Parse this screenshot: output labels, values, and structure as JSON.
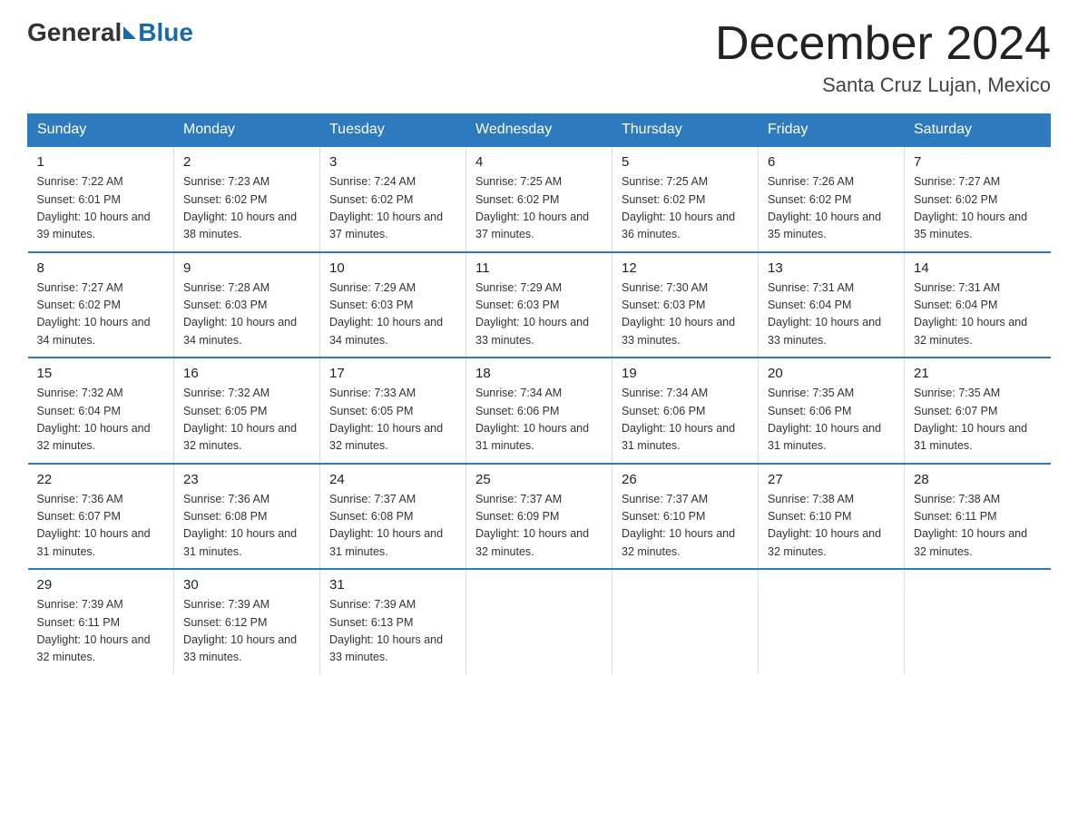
{
  "logo": {
    "general": "General",
    "blue": "Blue"
  },
  "title": "December 2024",
  "location": "Santa Cruz Lujan, Mexico",
  "days_of_week": [
    "Sunday",
    "Monday",
    "Tuesday",
    "Wednesday",
    "Thursday",
    "Friday",
    "Saturday"
  ],
  "weeks": [
    [
      {
        "day": "1",
        "sunrise": "7:22 AM",
        "sunset": "6:01 PM",
        "daylight": "10 hours and 39 minutes."
      },
      {
        "day": "2",
        "sunrise": "7:23 AM",
        "sunset": "6:02 PM",
        "daylight": "10 hours and 38 minutes."
      },
      {
        "day": "3",
        "sunrise": "7:24 AM",
        "sunset": "6:02 PM",
        "daylight": "10 hours and 37 minutes."
      },
      {
        "day": "4",
        "sunrise": "7:25 AM",
        "sunset": "6:02 PM",
        "daylight": "10 hours and 37 minutes."
      },
      {
        "day": "5",
        "sunrise": "7:25 AM",
        "sunset": "6:02 PM",
        "daylight": "10 hours and 36 minutes."
      },
      {
        "day": "6",
        "sunrise": "7:26 AM",
        "sunset": "6:02 PM",
        "daylight": "10 hours and 35 minutes."
      },
      {
        "day": "7",
        "sunrise": "7:27 AM",
        "sunset": "6:02 PM",
        "daylight": "10 hours and 35 minutes."
      }
    ],
    [
      {
        "day": "8",
        "sunrise": "7:27 AM",
        "sunset": "6:02 PM",
        "daylight": "10 hours and 34 minutes."
      },
      {
        "day": "9",
        "sunrise": "7:28 AM",
        "sunset": "6:03 PM",
        "daylight": "10 hours and 34 minutes."
      },
      {
        "day": "10",
        "sunrise": "7:29 AM",
        "sunset": "6:03 PM",
        "daylight": "10 hours and 34 minutes."
      },
      {
        "day": "11",
        "sunrise": "7:29 AM",
        "sunset": "6:03 PM",
        "daylight": "10 hours and 33 minutes."
      },
      {
        "day": "12",
        "sunrise": "7:30 AM",
        "sunset": "6:03 PM",
        "daylight": "10 hours and 33 minutes."
      },
      {
        "day": "13",
        "sunrise": "7:31 AM",
        "sunset": "6:04 PM",
        "daylight": "10 hours and 33 minutes."
      },
      {
        "day": "14",
        "sunrise": "7:31 AM",
        "sunset": "6:04 PM",
        "daylight": "10 hours and 32 minutes."
      }
    ],
    [
      {
        "day": "15",
        "sunrise": "7:32 AM",
        "sunset": "6:04 PM",
        "daylight": "10 hours and 32 minutes."
      },
      {
        "day": "16",
        "sunrise": "7:32 AM",
        "sunset": "6:05 PM",
        "daylight": "10 hours and 32 minutes."
      },
      {
        "day": "17",
        "sunrise": "7:33 AM",
        "sunset": "6:05 PM",
        "daylight": "10 hours and 32 minutes."
      },
      {
        "day": "18",
        "sunrise": "7:34 AM",
        "sunset": "6:06 PM",
        "daylight": "10 hours and 31 minutes."
      },
      {
        "day": "19",
        "sunrise": "7:34 AM",
        "sunset": "6:06 PM",
        "daylight": "10 hours and 31 minutes."
      },
      {
        "day": "20",
        "sunrise": "7:35 AM",
        "sunset": "6:06 PM",
        "daylight": "10 hours and 31 minutes."
      },
      {
        "day": "21",
        "sunrise": "7:35 AM",
        "sunset": "6:07 PM",
        "daylight": "10 hours and 31 minutes."
      }
    ],
    [
      {
        "day": "22",
        "sunrise": "7:36 AM",
        "sunset": "6:07 PM",
        "daylight": "10 hours and 31 minutes."
      },
      {
        "day": "23",
        "sunrise": "7:36 AM",
        "sunset": "6:08 PM",
        "daylight": "10 hours and 31 minutes."
      },
      {
        "day": "24",
        "sunrise": "7:37 AM",
        "sunset": "6:08 PM",
        "daylight": "10 hours and 31 minutes."
      },
      {
        "day": "25",
        "sunrise": "7:37 AM",
        "sunset": "6:09 PM",
        "daylight": "10 hours and 32 minutes."
      },
      {
        "day": "26",
        "sunrise": "7:37 AM",
        "sunset": "6:10 PM",
        "daylight": "10 hours and 32 minutes."
      },
      {
        "day": "27",
        "sunrise": "7:38 AM",
        "sunset": "6:10 PM",
        "daylight": "10 hours and 32 minutes."
      },
      {
        "day": "28",
        "sunrise": "7:38 AM",
        "sunset": "6:11 PM",
        "daylight": "10 hours and 32 minutes."
      }
    ],
    [
      {
        "day": "29",
        "sunrise": "7:39 AM",
        "sunset": "6:11 PM",
        "daylight": "10 hours and 32 minutes."
      },
      {
        "day": "30",
        "sunrise": "7:39 AM",
        "sunset": "6:12 PM",
        "daylight": "10 hours and 33 minutes."
      },
      {
        "day": "31",
        "sunrise": "7:39 AM",
        "sunset": "6:13 PM",
        "daylight": "10 hours and 33 minutes."
      },
      null,
      null,
      null,
      null
    ]
  ]
}
